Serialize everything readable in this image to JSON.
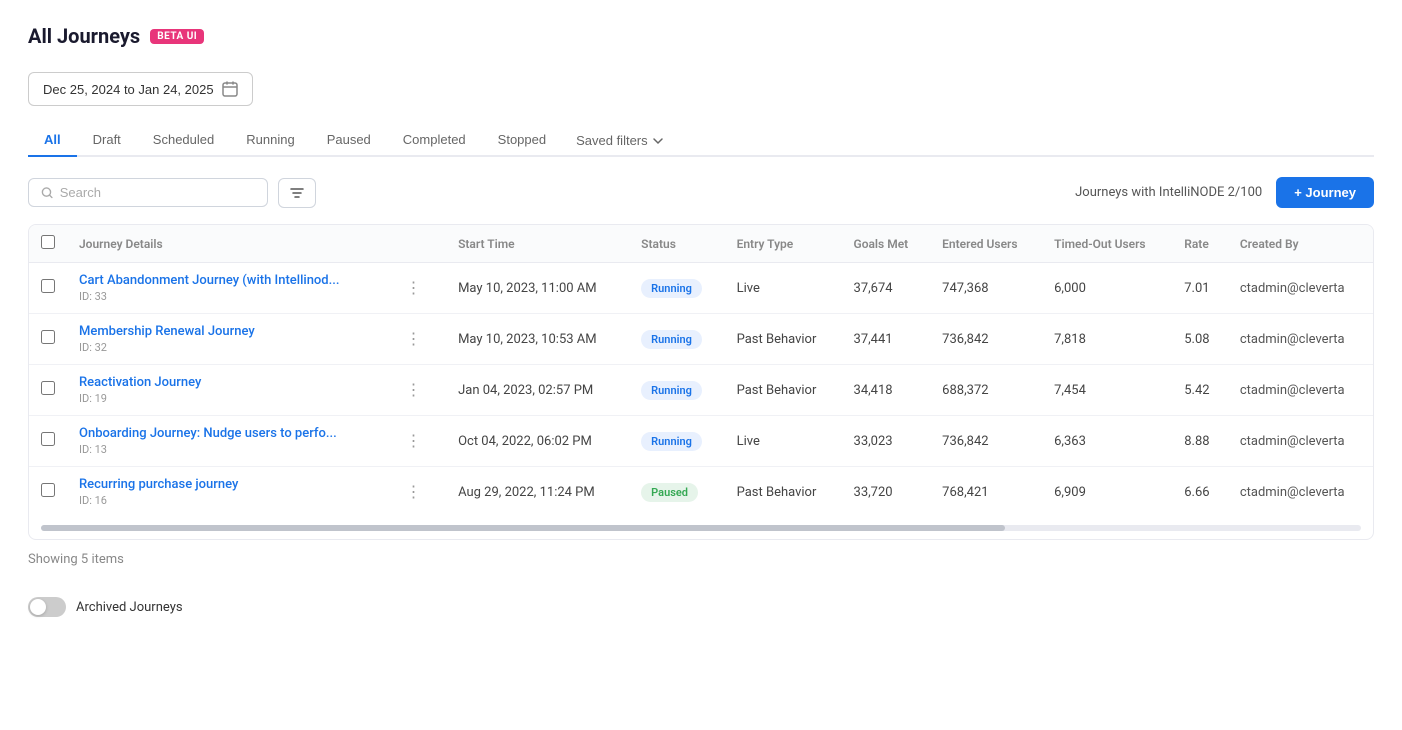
{
  "page": {
    "title": "All Journeys",
    "beta_label": "BETA UI"
  },
  "date_range": {
    "label": "Dec 25, 2024 to Jan 24, 2025"
  },
  "tabs": [
    {
      "id": "all",
      "label": "All",
      "active": true
    },
    {
      "id": "draft",
      "label": "Draft",
      "active": false
    },
    {
      "id": "scheduled",
      "label": "Scheduled",
      "active": false
    },
    {
      "id": "running",
      "label": "Running",
      "active": false
    },
    {
      "id": "paused",
      "label": "Paused",
      "active": false
    },
    {
      "id": "completed",
      "label": "Completed",
      "active": false
    },
    {
      "id": "stopped",
      "label": "Stopped",
      "active": false
    }
  ],
  "saved_filters_label": "Saved filters",
  "toolbar": {
    "search_placeholder": "Search",
    "intellinode_info": "Journeys with IntelliNODE 2/100",
    "add_journey_label": "+ Journey"
  },
  "table": {
    "columns": [
      {
        "id": "checkbox",
        "label": ""
      },
      {
        "id": "journey_details",
        "label": "Journey Details"
      },
      {
        "id": "actions",
        "label": ""
      },
      {
        "id": "start_time",
        "label": "Start Time"
      },
      {
        "id": "status",
        "label": "Status"
      },
      {
        "id": "entry_type",
        "label": "Entry Type"
      },
      {
        "id": "goals_met",
        "label": "Goals Met"
      },
      {
        "id": "entered_users",
        "label": "Entered Users"
      },
      {
        "id": "timed_out_users",
        "label": "Timed-Out Users"
      },
      {
        "id": "rate",
        "label": "Rate"
      },
      {
        "id": "created_by",
        "label": "Created By"
      }
    ],
    "rows": [
      {
        "id": 1,
        "name": "Cart Abandonment Journey (with Intellinod...",
        "journey_id": "ID: 33",
        "start_time": "May 10, 2023, 11:00 AM",
        "status": "Running",
        "status_type": "running",
        "entry_type": "Live",
        "goals_met": "37,674",
        "entered_users": "747,368",
        "timed_out_users": "6,000",
        "rate": "7.01",
        "created_by": "ctadmin@cleverta"
      },
      {
        "id": 2,
        "name": "Membership Renewal Journey",
        "journey_id": "ID: 32",
        "start_time": "May 10, 2023, 10:53 AM",
        "status": "Running",
        "status_type": "running",
        "entry_type": "Past Behavior",
        "goals_met": "37,441",
        "entered_users": "736,842",
        "timed_out_users": "7,818",
        "rate": "5.08",
        "created_by": "ctadmin@cleverta"
      },
      {
        "id": 3,
        "name": "Reactivation Journey",
        "journey_id": "ID: 19",
        "start_time": "Jan 04, 2023, 02:57 PM",
        "status": "Running",
        "status_type": "running",
        "entry_type": "Past Behavior",
        "goals_met": "34,418",
        "entered_users": "688,372",
        "timed_out_users": "7,454",
        "rate": "5.42",
        "created_by": "ctadmin@cleverta"
      },
      {
        "id": 4,
        "name": "Onboarding Journey: Nudge users to perfo...",
        "journey_id": "ID: 13",
        "start_time": "Oct 04, 2022, 06:02 PM",
        "status": "Running",
        "status_type": "running",
        "entry_type": "Live",
        "goals_met": "33,023",
        "entered_users": "736,842",
        "timed_out_users": "6,363",
        "rate": "8.88",
        "created_by": "ctadmin@cleverta"
      },
      {
        "id": 5,
        "name": "Recurring purchase journey",
        "journey_id": "ID: 16",
        "start_time": "Aug 29, 2022, 11:24 PM",
        "status": "Paused",
        "status_type": "paused",
        "entry_type": "Past Behavior",
        "goals_met": "33,720",
        "entered_users": "768,421",
        "timed_out_users": "6,909",
        "rate": "6.66",
        "created_by": "ctadmin@cleverta"
      }
    ]
  },
  "footer": {
    "showing_label": "Showing 5 items"
  },
  "archived_journeys_label": "Archived Journeys"
}
